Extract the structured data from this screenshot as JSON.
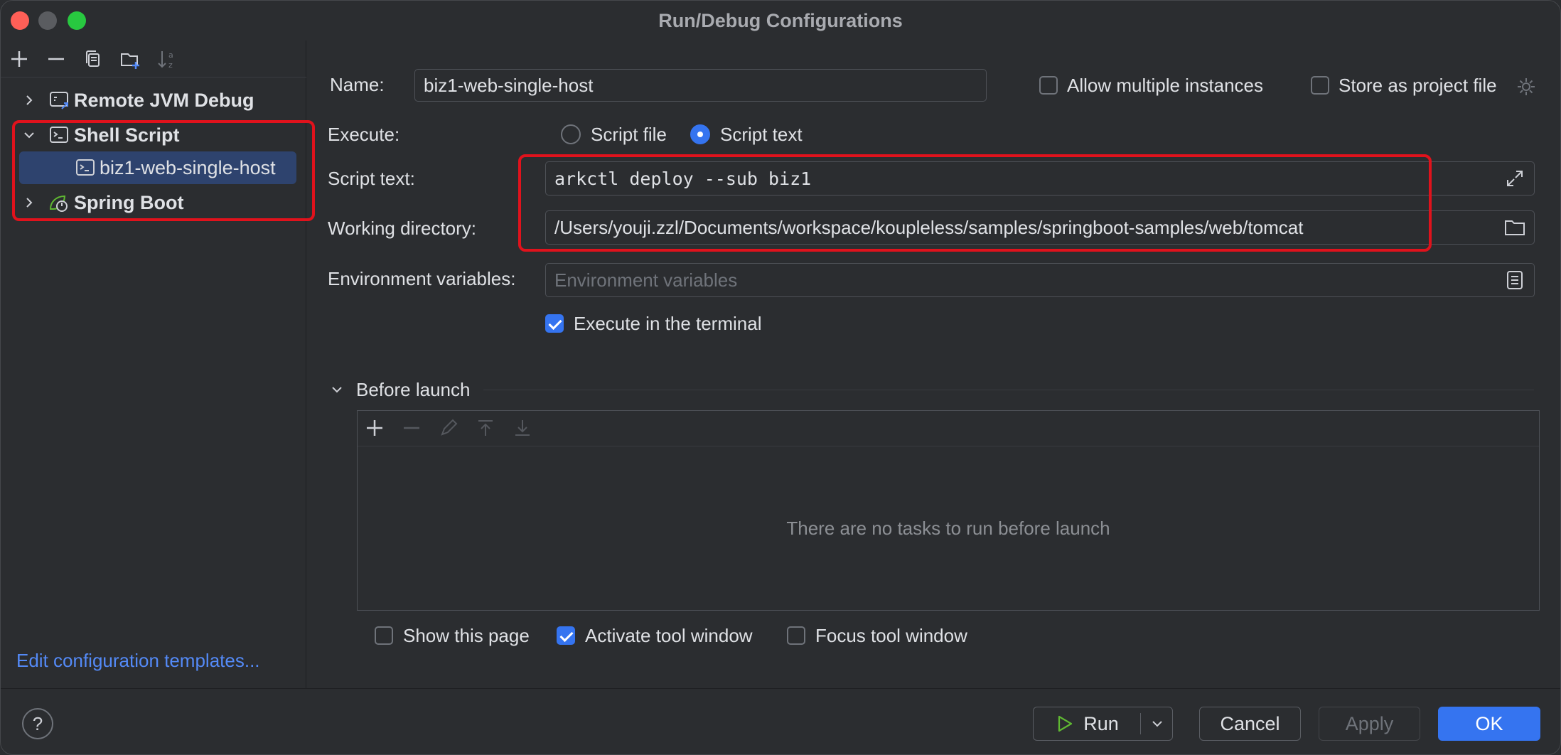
{
  "window": {
    "title": "Run/Debug Configurations"
  },
  "sidebar": {
    "tree": [
      {
        "label": "Remote JVM Debug",
        "icon": "remote-debug-icon",
        "expanded": false
      },
      {
        "label": "Shell Script",
        "icon": "terminal-icon",
        "expanded": true
      },
      {
        "label": "biz1-web-single-host",
        "icon": "terminal-icon",
        "selected": true
      },
      {
        "label": "Spring Boot",
        "icon": "spring-boot-icon",
        "expanded": false
      }
    ],
    "edit_templates_link": "Edit configuration templates..."
  },
  "form": {
    "name_label": "Name:",
    "name_value": "biz1-web-single-host",
    "allow_multiple_label": "Allow multiple instances",
    "store_project_label": "Store as project file",
    "execute_label": "Execute:",
    "script_file_label": "Script file",
    "script_text_option_label": "Script text",
    "script_text_label": "Script text:",
    "script_text_value": "arkctl deploy --sub biz1",
    "working_dir_label": "Working directory:",
    "working_dir_value": "/Users/youji.zzl/Documents/workspace/koupleless/samples/springboot-samples/web/tomcat",
    "env_label": "Environment variables:",
    "env_placeholder": "Environment variables",
    "execute_terminal_label": "Execute in the terminal",
    "execute_terminal_checked": true
  },
  "before_launch": {
    "title": "Before launch",
    "empty_text": "There are no tasks to run before launch",
    "show_page_label": "Show this page",
    "show_page_checked": false,
    "activate_label": "Activate tool window",
    "activate_checked": true,
    "focus_label": "Focus tool window",
    "focus_checked": false
  },
  "footer": {
    "help": "?",
    "run": "Run",
    "cancel": "Cancel",
    "apply": "Apply",
    "ok": "OK"
  },
  "colors": {
    "accent": "#3574f0",
    "highlight": "#e0121c",
    "link": "#548af7",
    "background": "#2b2d30"
  }
}
